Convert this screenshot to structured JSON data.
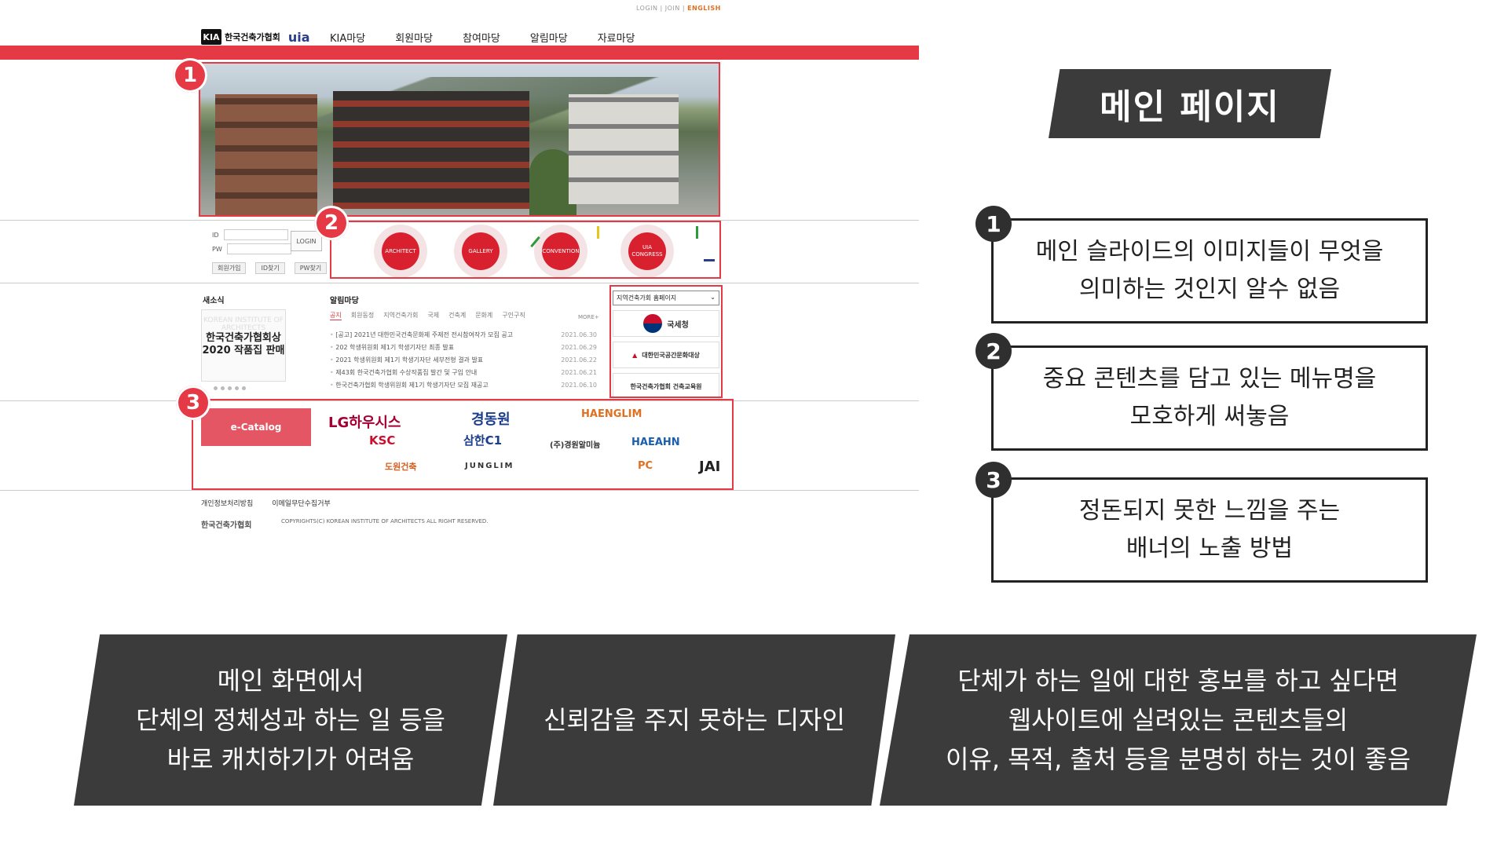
{
  "site": {
    "toplinks": {
      "login": "LOGIN",
      "join": "JOIN",
      "english": "ENGLISH",
      "sep": " | "
    },
    "logo": {
      "text": "한국건축가협회",
      "sub": "KOREAN INSTITUTE OF ARCHITECTS",
      "uia": "uia"
    },
    "nav": [
      "KIA마당",
      "회원마당",
      "참여마당",
      "알림마당",
      "자료마당"
    ],
    "markers": [
      "1",
      "2",
      "3"
    ],
    "login": {
      "id_label": "ID",
      "pw_label": "PW",
      "button": "LOGIN",
      "join": "회원가입",
      "find_id": "ID찾기",
      "find_pw": "PW찾기"
    },
    "quick_links": [
      "ARCHITECT",
      "GALLERY",
      "CONVENTION",
      "UIA CONGRESS"
    ],
    "news": {
      "title": "새소식",
      "thumb_title": "한국건축가협회상 2020 작품집 판매",
      "thumb_watermark": "KOREAN INSTITUTE OF ARCHITECTS"
    },
    "notice": {
      "title": "알림마당",
      "tabs": [
        "공지",
        "회원동정",
        "지역건축가회",
        "국제",
        "건축계",
        "문화계",
        "구인구직"
      ],
      "more": "MORE+",
      "items": [
        {
          "text": "[공고] 2021년 대한민국건축문화제 주제전 전시참여작가 모집 공고",
          "date": "2021.06.30"
        },
        {
          "text": "202 학생위원회 제1기 학생기자단 최종 발표",
          "date": "2021.06.29"
        },
        {
          "text": "2021 학생위원회 제1기 학생기자단 세부전형 결과 발표",
          "date": "2021.06.22"
        },
        {
          "text": "제43회 한국건축가협회 수상작품집 발간 및 구입 안내",
          "date": "2021.06.21"
        },
        {
          "text": "한국건축가협회 학생위원회 제1기 학생기자단 모집 재공고",
          "date": "2021.06.10"
        }
      ]
    },
    "region": {
      "select": "지역건축가회 홈페이지",
      "cards": [
        "국세청",
        "대한민국공간문화대상",
        "한국건축가협회 건축교육원"
      ]
    },
    "banners": {
      "ecatalog": "e-Catalog",
      "brands": [
        "LG하우시스",
        "경동원",
        "HAENGLIM",
        "KSC",
        "삼한C1",
        "(주)경원알미늄",
        "HAEAHN",
        "도원건축",
        "JUNGLIM",
        "JAI",
        "PC"
      ]
    },
    "footer": {
      "links": [
        "개인정보처리방침",
        "이메일무단수집거부"
      ],
      "logo": "한국건축가협회",
      "copyright": "COPYRIGHTS(C) KOREAN INSTITUTE OF ARCHITECTS ALL RIGHT RESERVED."
    }
  },
  "panel": {
    "title": "메인 페이지",
    "notes": [
      {
        "num": "1",
        "lines": [
          "메인 슬라이드의 이미지들이 무엇을",
          "의미하는 것인지 알수 없음"
        ]
      },
      {
        "num": "2",
        "lines": [
          "중요 콘텐츠를 담고 있는 메뉴명을",
          "모호하게 써놓음"
        ]
      },
      {
        "num": "3",
        "lines": [
          "정돈되지 못한 느낌을 주는",
          "배너의 노출 방법"
        ]
      }
    ]
  },
  "summary": [
    {
      "lines": [
        "메인 화면에서",
        "단체의 정체성과 하는 일 등을",
        "바로 캐치하기가 어려움"
      ]
    },
    {
      "lines": [
        "신뢰감을 주지 못하는 디자인"
      ]
    },
    {
      "lines": [
        "단체가 하는 일에 대한 홍보를 하고 싶다면",
        "웹사이트에 실려있는 콘텐츠들의",
        "이유, 목적, 출처 등을 분명히 하는 것이 좋음"
      ]
    }
  ],
  "colors": {
    "accent": "#e63946",
    "dark": "#3b3b3b"
  }
}
